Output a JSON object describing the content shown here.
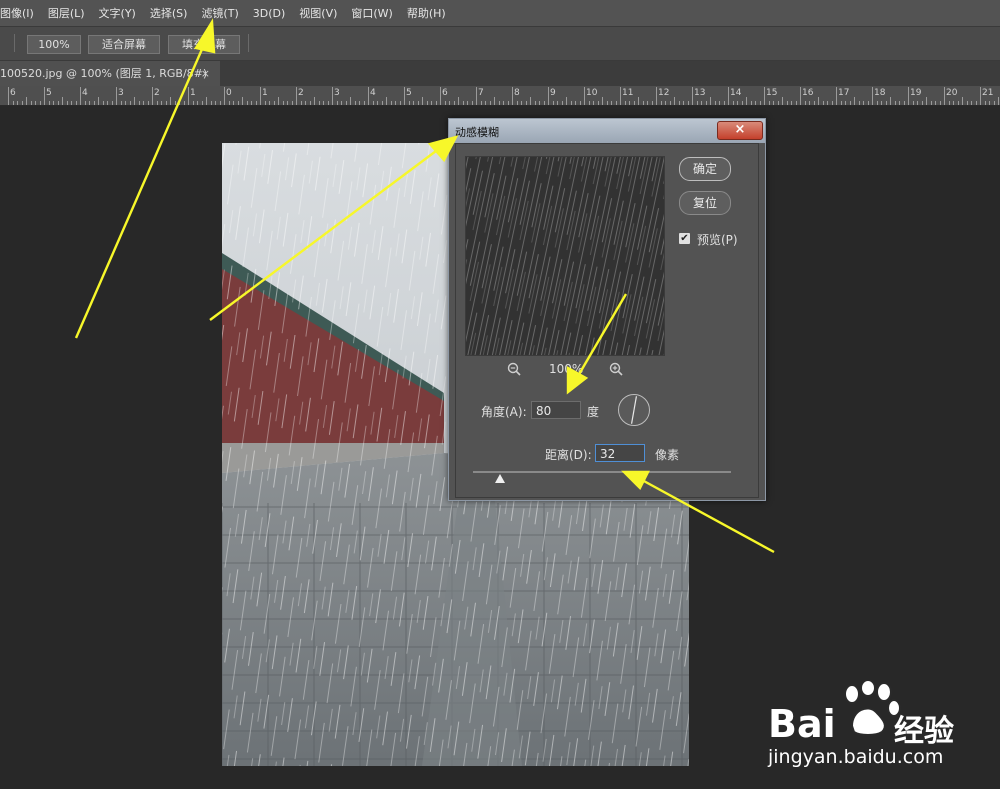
{
  "menu": [
    "图像(I)",
    "图层(L)",
    "文字(Y)",
    "选择(S)",
    "滤镜(T)",
    "3D(D)",
    "视图(V)",
    "窗口(W)",
    "帮助(H)"
  ],
  "options": {
    "zoom_100": "100%",
    "fit_screen": "适合屏幕",
    "fill_screen": "填充屏幕"
  },
  "tab": {
    "title": "100520.jpg @ 100% (图层 1, RGB/8#)",
    "close": "×"
  },
  "ruler": {
    "labels": [
      "6",
      "5",
      "4",
      "3",
      "2",
      "1",
      "0",
      "1",
      "2",
      "3",
      "4",
      "5",
      "6",
      "7",
      "8",
      "9",
      "10",
      "11",
      "12",
      "13",
      "14",
      "15",
      "16",
      "17",
      "18",
      "19",
      "20",
      "21"
    ]
  },
  "dialog": {
    "title": "动感模糊",
    "close": "×",
    "ok_label": "确定",
    "reset_label": "复位",
    "preview_label": "预览(P)",
    "preview_checked": true,
    "zoom_value": "100%",
    "angle_label": "角度(A):",
    "angle_value": "80",
    "angle_unit": "度",
    "distance_label": "距离(D):",
    "distance_value": "32",
    "distance_unit": "像素"
  },
  "watermark": {
    "logo_word": "Bai",
    "logo_suffix": "经验",
    "url": "jingyan.baidu.com"
  },
  "colors": {
    "annotation_arrow": "#f7f72a",
    "dialog_title": "#9aa6b4",
    "close_button": "#c4402c",
    "focus": "#4f8fd6"
  }
}
